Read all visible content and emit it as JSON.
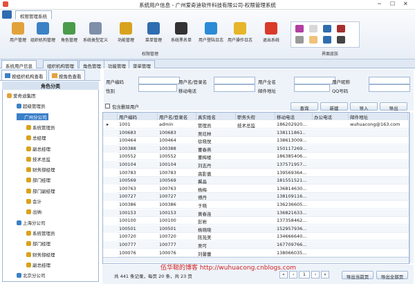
{
  "window": {
    "title": "系统用户信息 - 广州爱奇迪软件科技有限公司-权限管理系统",
    "ribbon_tab": "权限管理系统"
  },
  "ribbon": {
    "buttons": [
      {
        "label": "用户管理",
        "color": "#e2a23b"
      },
      {
        "label": "组织机构管理",
        "color": "#3b82c4"
      },
      {
        "label": "角色管理",
        "color": "#4a9b4a"
      },
      {
        "label": "系统类型定义",
        "color": "#7e8fa8"
      },
      {
        "label": "功能管理",
        "color": "#d8a21c"
      },
      {
        "label": "菜单管理",
        "color": "#2f6db0"
      },
      {
        "label": "系统黑名单",
        "color": "#333333"
      },
      {
        "label": "用户登陆日志",
        "color": "#2b8bd6"
      },
      {
        "label": "用户操作日志",
        "color": "#e7b52a"
      },
      {
        "label": "退出系统",
        "color": "#d93a2a"
      }
    ],
    "group_label": "权限管理",
    "skin_label": "界面皮肤"
  },
  "tabs": [
    "系统用户信息",
    "组织机构管理",
    "角色管理",
    "功能管理",
    "菜单管理"
  ],
  "left_tabs": [
    "按组织机构查看",
    "按角色查看"
  ],
  "tree": {
    "header": "角色分类",
    "items": [
      {
        "label": "爱奇迪集团",
        "lvl": 0
      },
      {
        "label": "超级管理员",
        "lvl": 1
      },
      {
        "label": "广州分公司",
        "lvl": 1,
        "sel": true
      },
      {
        "label": "系统管理员",
        "lvl": 2
      },
      {
        "label": "总经理",
        "lvl": 2
      },
      {
        "label": "副总经理",
        "lvl": 2
      },
      {
        "label": "技术总监",
        "lvl": 2
      },
      {
        "label": "财务部经理",
        "lvl": 2
      },
      {
        "label": "部门经理",
        "lvl": 2
      },
      {
        "label": "部门副经理",
        "lvl": 2
      },
      {
        "label": "会计",
        "lvl": 2
      },
      {
        "label": "出纳",
        "lvl": 2
      },
      {
        "label": "上海分公司",
        "lvl": 1
      },
      {
        "label": "系统管理员",
        "lvl": 2
      },
      {
        "label": "部门经理",
        "lvl": 2
      },
      {
        "label": "财务部经理",
        "lvl": 2
      },
      {
        "label": "副总经理",
        "lvl": 2
      },
      {
        "label": "北京分公司",
        "lvl": 1
      }
    ]
  },
  "form": {
    "labels": [
      "用户编码",
      "用户名/登录名",
      "用户全名",
      "用户昵称",
      "性别",
      "移动电话",
      "邮件地址",
      "QQ号码"
    ],
    "checkbox": "包含删除用户",
    "buttons": [
      "查询",
      "新建",
      "导入",
      "导出"
    ]
  },
  "grid": {
    "columns": [
      "用户编码",
      "用户名/登录名",
      "真实姓名",
      "职务头衔",
      "移动电话",
      "办公电话",
      "邮件地址"
    ],
    "rows": [
      [
        "1001",
        "admin",
        "管理员",
        "技术总监",
        "186202920...",
        "",
        "wuhuacong@163.com"
      ],
      [
        "100683",
        "100683",
        "吴珏林",
        "",
        "138111861..",
        "",
        ""
      ],
      [
        "100464",
        "100464",
        "徐晓悦",
        "",
        "138613009...",
        "",
        ""
      ],
      [
        "100388",
        "100388",
        "董春燕",
        "",
        "150117269...",
        "",
        ""
      ],
      [
        "100552",
        "100552",
        "董梅楼",
        "",
        "186385406...",
        "",
        ""
      ],
      [
        "100104",
        "100104",
        "刘志丹",
        "",
        "137571957...",
        "",
        ""
      ],
      [
        "100783",
        "100783",
        "龚影蔷",
        "",
        "139569364...",
        "",
        ""
      ],
      [
        "100569",
        "100569",
        "冀晶",
        "",
        "181551521...",
        "",
        ""
      ],
      [
        "100763",
        "100763",
        "杨梅",
        "",
        "136814630...",
        "",
        ""
      ],
      [
        "100727",
        "100727",
        "傅丹",
        "",
        "138109116...",
        "",
        ""
      ],
      [
        "100386",
        "100386",
        "于晓",
        "",
        "136236605...",
        "",
        ""
      ],
      [
        "100153",
        "100153",
        "黄春连",
        "",
        "136821633...",
        "",
        ""
      ],
      [
        "100100",
        "100100",
        "彭岩",
        "",
        "137358462...",
        "",
        ""
      ],
      [
        "100501",
        "100501",
        "杨晓晓",
        "",
        "152957936...",
        "",
        ""
      ],
      [
        "100720",
        "100720",
        "陈苑美",
        "",
        "134666640...",
        "",
        ""
      ],
      [
        "100777",
        "100777",
        "吴可",
        "",
        "167709766...",
        "",
        ""
      ],
      [
        "100076",
        "100076",
        "刘馨蕾",
        "",
        "138066035...",
        "",
        ""
      ]
    ]
  },
  "footer": {
    "summary": "共 441 条记录，每页 20 条，共 23 页",
    "page": "1",
    "export_page": "导出当前页",
    "export_all": "导出全部页"
  },
  "watermark": "伍华聪的博客 http://wuhuacong.cnblogs.com"
}
